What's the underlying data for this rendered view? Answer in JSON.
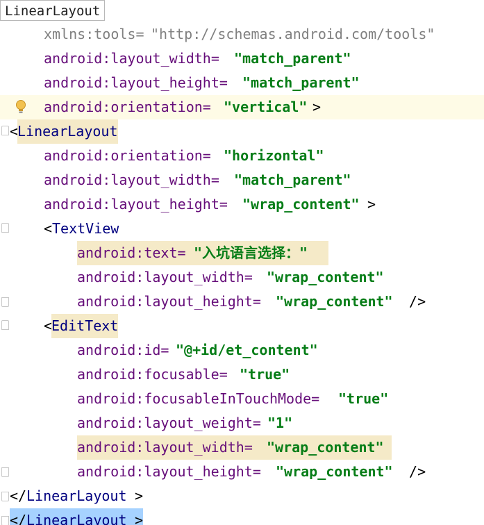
{
  "breadcrumb": {
    "label": "LinearLayout"
  },
  "lines": [
    {
      "parts": [
        "xmlns:tools=",
        "\"http://schemas.android.com/tools\""
      ]
    },
    {
      "parts": [
        "android:layout_width=",
        "\"match_parent\""
      ]
    },
    {
      "parts": [
        "android:layout_height=",
        "\"match_parent\""
      ]
    },
    {
      "parts": [
        "android:orientation=",
        "\"vertical\"",
        ">"
      ]
    },
    {
      "parts": [
        "<",
        "LinearLayout"
      ]
    },
    {
      "parts": [
        "android:orientation=",
        "\"horizontal\""
      ]
    },
    {
      "parts": [
        "android:layout_width=",
        "\"match_parent\""
      ]
    },
    {
      "parts": [
        "android:layout_height=",
        "\"wrap_content\"",
        ">"
      ]
    },
    {
      "parts": [
        "<",
        "TextView"
      ]
    },
    {
      "parts": [
        "android:text=",
        "\"入坑语言选择：\""
      ]
    },
    {
      "parts": [
        "android:layout_width=",
        "\"wrap_content\""
      ]
    },
    {
      "parts": [
        "android:layout_height=",
        "\"wrap_content\"",
        " />"
      ]
    },
    {
      "parts": [
        "<",
        "EditText"
      ]
    },
    {
      "parts": [
        "android:id=",
        "\"@+id/et_content\""
      ]
    },
    {
      "parts": [
        "android:focusable=",
        "\"true\""
      ]
    },
    {
      "parts": [
        "android:focusableInTouchMode=",
        "\"true\""
      ]
    },
    {
      "parts": [
        "android:layout_weight=",
        "\"1\""
      ]
    },
    {
      "parts": [
        "android:layout_width=",
        "\"wrap_content\""
      ]
    },
    {
      "parts": [
        "android:layout_height=",
        "\"wrap_content\"",
        " />"
      ]
    },
    {
      "parts": [
        "</",
        "LinearLayout",
        ">"
      ]
    },
    {
      "parts": [
        "</",
        "LinearLayout",
        ">"
      ]
    }
  ],
  "icons": {
    "intention": "lightbulb-icon",
    "fold": "fold-marker-icon"
  },
  "colors": {
    "attribute": "#660e7a",
    "value": "#067d17",
    "tag": "#000080",
    "namespace": "#808080",
    "highlight": "#f5eac8",
    "selection": "#a6d2ff",
    "caret_row": "#fefbe6"
  }
}
